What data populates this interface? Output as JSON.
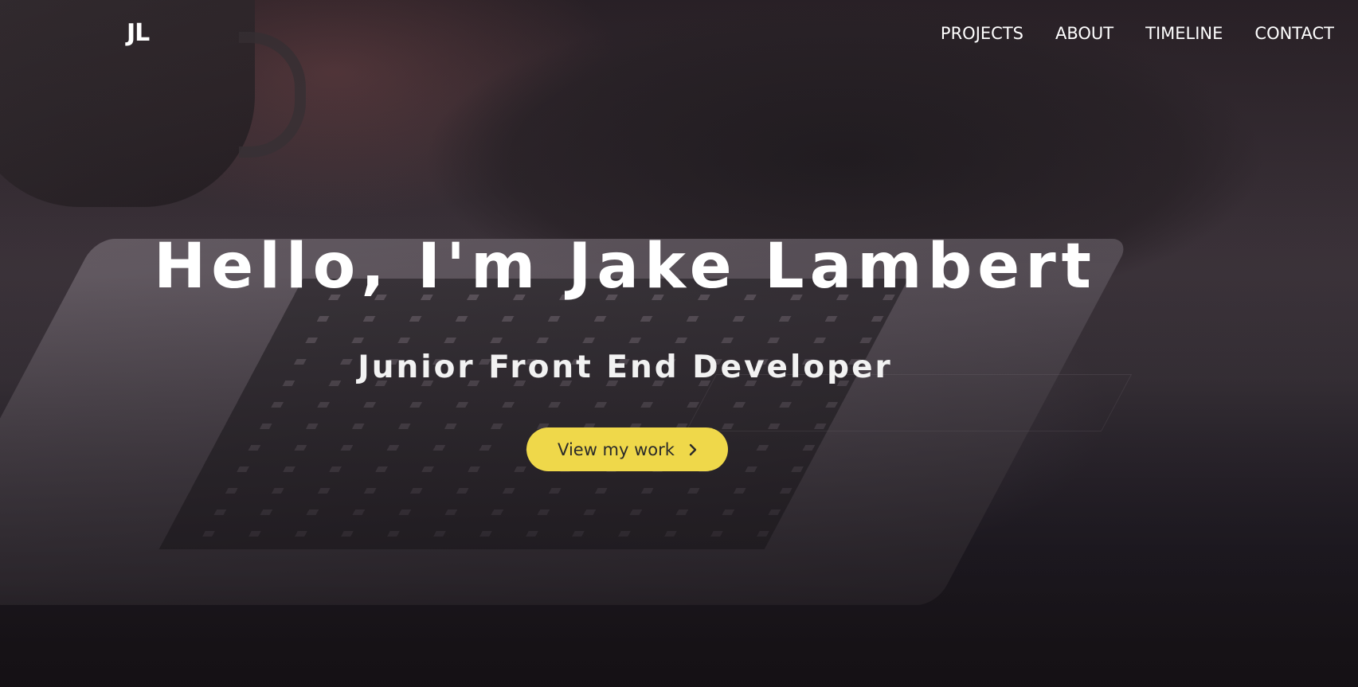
{
  "header": {
    "logo_text": "JL",
    "nav": [
      {
        "label": "PROJECTS"
      },
      {
        "label": "ABOUT"
      },
      {
        "label": "TIMELINE"
      },
      {
        "label": "CONTACT"
      }
    ]
  },
  "hero": {
    "title": "Hello, I'm Jake Lambert",
    "subtitle": "Junior Front End Developer",
    "cta_label": "View my work",
    "cta_icon": "chevron-right-icon",
    "accent_color": "#efd84a"
  }
}
